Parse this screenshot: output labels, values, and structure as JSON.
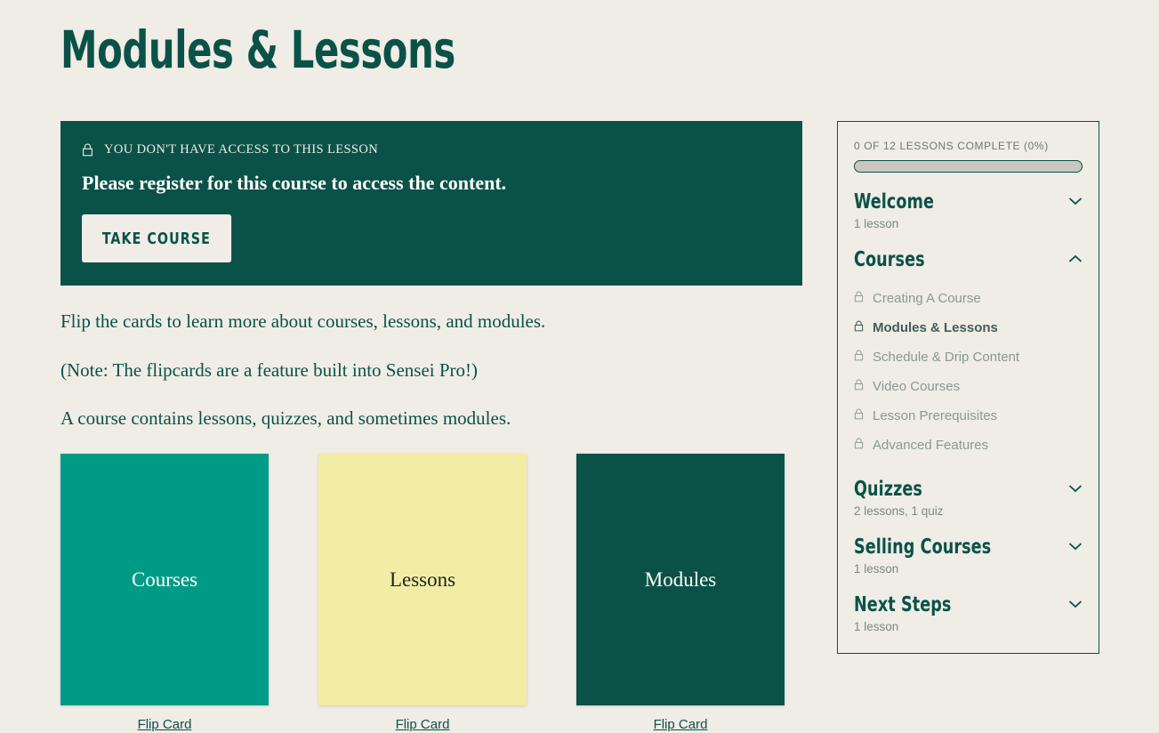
{
  "page": {
    "title": "Modules & Lessons",
    "background_color": "#f0ece6"
  },
  "colors": {
    "dark_teal": "#0a5248",
    "bright_teal": "#009b87",
    "pale_yellow": "#f2eda5",
    "cream": "#f0ece6",
    "muted_text": "#8a9992"
  },
  "notice": {
    "lock_icon": "lock-icon",
    "eyebrow": "YOU DON'T HAVE ACCESS TO THIS LESSON",
    "heading": "Please register for this course to access the content.",
    "button_label": "TAKE COURSE"
  },
  "body": {
    "paragraphs": [
      "Flip the cards to learn more about courses, lessons, and modules.",
      "(Note: The flipcards are a feature built into Sensei Pro!)",
      "A course contains lessons, quizzes, and sometimes modules."
    ]
  },
  "cards": [
    {
      "title": "Courses",
      "bg": "#009b87",
      "fg": "#ffffff",
      "flip_label": "Flip Card"
    },
    {
      "title": "Lessons",
      "bg": "#f2eda5",
      "fg": "#1d2320",
      "flip_label": "Flip Card"
    },
    {
      "title": "Modules",
      "bg": "#0a5248",
      "fg": "#ffffff",
      "flip_label": "Flip Card"
    }
  ],
  "sidebar": {
    "progress": {
      "label": "0 OF 12 LESSONS COMPLETE (0%)",
      "percent": 0,
      "completed": 0,
      "total": 12
    },
    "modules": [
      {
        "name": "Welcome",
        "meta": "1 lesson",
        "expanded": false,
        "chevron": "chevron-down-icon",
        "lessons": []
      },
      {
        "name": "Courses",
        "meta": "",
        "expanded": true,
        "chevron": "chevron-up-icon",
        "lessons": [
          {
            "label": "Creating A Course",
            "locked": true,
            "current": false
          },
          {
            "label": "Modules & Lessons",
            "locked": true,
            "current": true
          },
          {
            "label": "Schedule & Drip Content",
            "locked": true,
            "current": false
          },
          {
            "label": "Video Courses",
            "locked": true,
            "current": false
          },
          {
            "label": "Lesson Prerequisites",
            "locked": true,
            "current": false
          },
          {
            "label": "Advanced Features",
            "locked": true,
            "current": false
          }
        ]
      },
      {
        "name": "Quizzes",
        "meta": "2 lessons, 1 quiz",
        "expanded": false,
        "chevron": "chevron-down-icon",
        "lessons": []
      },
      {
        "name": "Selling Courses",
        "meta": "1 lesson",
        "expanded": false,
        "chevron": "chevron-down-icon",
        "lessons": []
      },
      {
        "name": "Next Steps",
        "meta": "1 lesson",
        "expanded": false,
        "chevron": "chevron-down-icon",
        "lessons": []
      }
    ]
  }
}
